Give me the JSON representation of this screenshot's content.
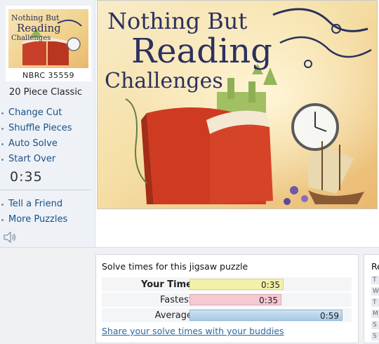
{
  "thumbnail": {
    "id": "NBRC 35559"
  },
  "puzzle_type": "20 Piece Classic",
  "menu": [
    {
      "label": "Change Cut"
    },
    {
      "label": "Shuffle Pieces"
    },
    {
      "label": "Auto Solve"
    },
    {
      "label": "Start Over"
    }
  ],
  "timer": "0:35",
  "menu2": [
    {
      "label": "Tell a Friend"
    },
    {
      "label": "More Puzzles"
    }
  ],
  "image_text": {
    "line1": "Nothing But",
    "line2": "Reading",
    "line3": "Challenges"
  },
  "solve_times": {
    "title": "Solve times for this jigsaw puzzle",
    "rows": [
      {
        "label": "Your Time",
        "value": "0:35"
      },
      {
        "label": "Fastest",
        "value": "0:35"
      },
      {
        "label": "Average",
        "value": "0:59"
      }
    ],
    "share_link": "Share your solve times with your buddies"
  },
  "side_panel": {
    "title": "Re",
    "items": [
      "T",
      "W",
      "T",
      "M",
      "S",
      "S"
    ]
  },
  "colors": {
    "your_time": "#f3f0a8",
    "fastest": "#f5c9d2",
    "average": "#b7d3ea",
    "link": "#1a4f86"
  }
}
